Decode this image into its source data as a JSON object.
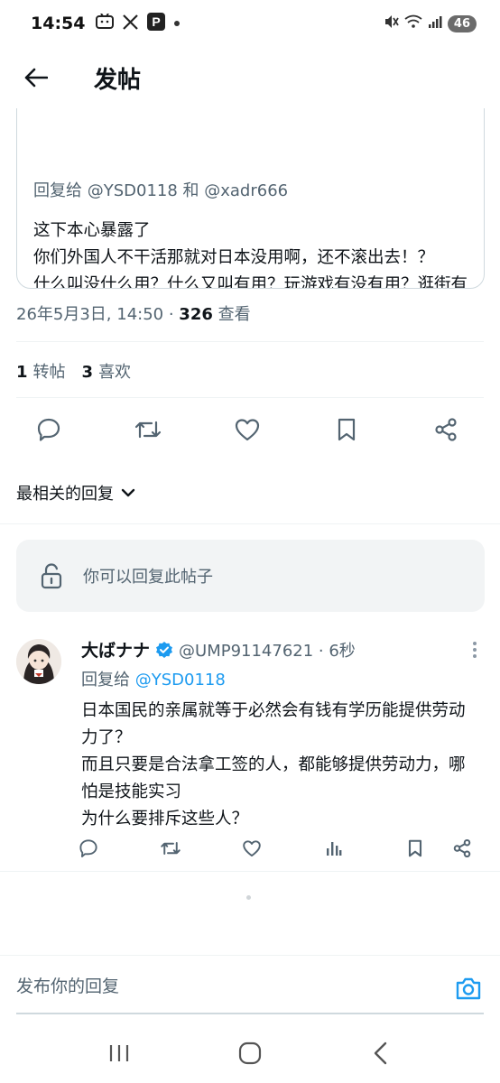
{
  "status_bar": {
    "time": "14:54",
    "battery": "46"
  },
  "header": {
    "title": "发帖"
  },
  "quoted_post": {
    "reply_to": "回复给 @YSD0118 和 @xadr666",
    "text": "这下本心暴露了\n你们外国人不干活那就对日本没用啊，还不滚出去！？\n什么叫没什么用？什么又叫有用？玩游戏有没有用？逛街有没有用？吃高档料理有没有用？..."
  },
  "meta": {
    "timestamp": "26年5月3日, 14:50 · ",
    "views": "326",
    "views_label": " 查看"
  },
  "stats": {
    "reposts_count": "1",
    "reposts_label": "转帖",
    "likes_count": "3",
    "likes_label": "喜欢"
  },
  "sort": {
    "label": "最相关的回复"
  },
  "reply_banner": {
    "text": "你可以回复此帖子"
  },
  "reply": {
    "name": "大ばナナ",
    "handle_time": "@UMP91147621 · 6秒",
    "reply_to_prefix": "回复给 ",
    "reply_to_handle": "@YSD0118",
    "text": "日本国民的亲属就等于必然会有钱有学历能提供劳动力了？\n而且只要是合法拿工签的人，都能够提供劳动力，哪怕是技能实习\n为什么要排斥这些人？"
  },
  "compose": {
    "placeholder": "发布你的回复"
  },
  "colors": {
    "accent": "#1d9bf0",
    "text": "#0f1419",
    "muted": "#536471"
  }
}
